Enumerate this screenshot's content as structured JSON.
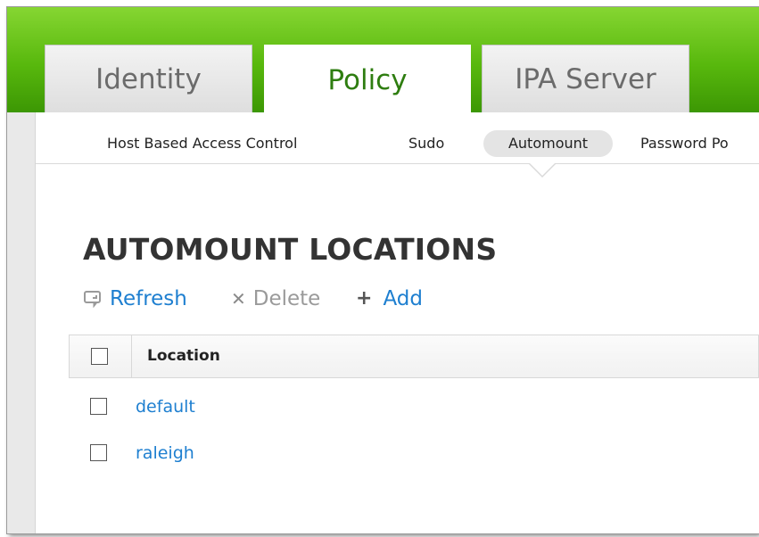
{
  "tabs": [
    {
      "label": "Identity",
      "active": false
    },
    {
      "label": "Policy",
      "active": true
    },
    {
      "label": "IPA Server",
      "active": false
    }
  ],
  "subnav": [
    {
      "label": "Host Based Access Control",
      "selected": false
    },
    {
      "label": "Sudo",
      "selected": false
    },
    {
      "label": "Automount",
      "selected": true
    },
    {
      "label": "Password Po",
      "selected": false
    }
  ],
  "page_title": "AUTOMOUNT LOCATIONS",
  "toolbar": {
    "refresh": {
      "label": "Refresh",
      "icon": "refresh-icon",
      "enabled": true
    },
    "delete": {
      "label": "Delete",
      "icon": "x-icon",
      "enabled": false
    },
    "add": {
      "label": "Add",
      "icon": "plus-icon",
      "enabled": true
    }
  },
  "table": {
    "columns": [
      "Location"
    ],
    "rows": [
      "default",
      "raleigh"
    ]
  },
  "colors": {
    "header_green": "#58b80d",
    "active_tab_text": "#2e7d10",
    "link_blue": "#1e7fd0"
  }
}
